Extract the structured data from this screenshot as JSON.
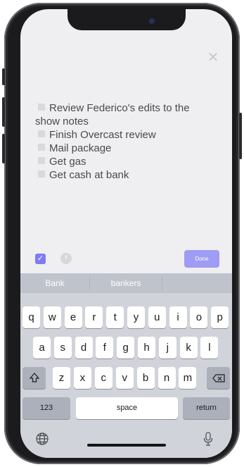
{
  "notes": {
    "items": [
      {
        "line1": "Review Federico's edits to the",
        "line2": "show notes"
      },
      {
        "line1": "Finish Overcast review"
      },
      {
        "line1": "Mail package"
      },
      {
        "line1": "Get gas"
      },
      {
        "line1": "Get cash at bank"
      }
    ]
  },
  "toolbar": {
    "done_label": "Done",
    "checkbox_icon": "check-icon",
    "clock_icon": "clock-icon"
  },
  "keyboard": {
    "suggestions": [
      "Bank",
      "bankers",
      ""
    ],
    "row1": [
      "q",
      "w",
      "e",
      "r",
      "t",
      "y",
      "u",
      "i",
      "o",
      "p"
    ],
    "row2": [
      "a",
      "s",
      "d",
      "f",
      "g",
      "h",
      "j",
      "k",
      "l"
    ],
    "row3": [
      "z",
      "x",
      "c",
      "v",
      "b",
      "n",
      "m"
    ],
    "numbers_label": "123",
    "space_label": "space",
    "return_label": "return",
    "shift_icon": "shift-icon",
    "delete_icon": "delete-icon",
    "globe_icon": "globe-icon",
    "mic_icon": "microphone-icon"
  },
  "colors": {
    "accent": "#7e7cf0",
    "done": "#9e9cf4",
    "screen_bg": "#efeff1",
    "keyboard_bg": "#d0d3da"
  }
}
